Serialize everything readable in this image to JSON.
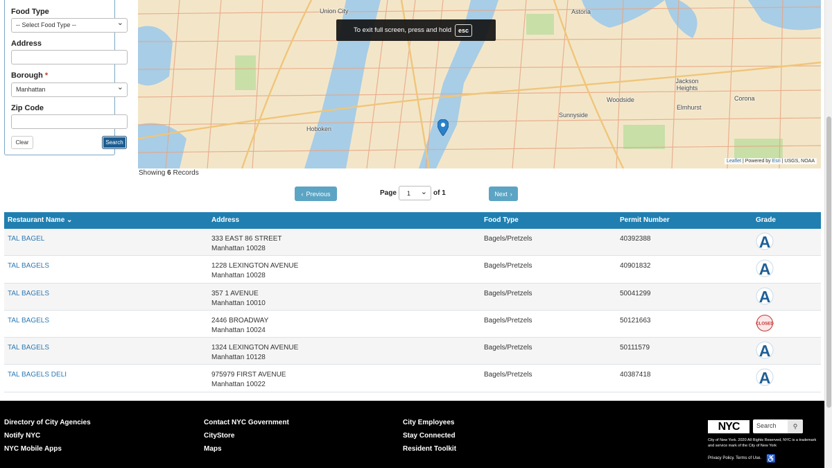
{
  "search_panel": {
    "food_type_label": "Food Type",
    "food_type_value": "-- Select Food Type --",
    "address_label": "Address",
    "address_value": "",
    "borough_label": "Borough",
    "borough_required": "*",
    "borough_value": "Manhattan",
    "zip_label": "Zip Code",
    "zip_value": "",
    "clear_label": "Clear",
    "search_label": "Search"
  },
  "map": {
    "places": {
      "union_city": "Union City",
      "astoria": "Astoria",
      "jackson_heights": "Jackson Heights",
      "woodside": "Woodside",
      "elmhurst": "Elmhurst",
      "corona": "Corona",
      "sunnyside": "Sunnyside",
      "hoboken": "Hoboken"
    },
    "fullscreen_toast_text": "To exit full screen, press and hold",
    "fullscreen_toast_key": "esc",
    "attribution_leaflet": "Leaflet",
    "attribution_powered": "| Powered by",
    "attribution_esri": "Esri",
    "attribution_rest": "| USGS, NOAA"
  },
  "results": {
    "showing_prefix": "Showing",
    "showing_count": "6",
    "showing_suffix": "Records"
  },
  "pagination": {
    "previous_label": "Previous",
    "page_label": "Page",
    "page_value": "1",
    "of_label": "of 1",
    "next_label": "Next"
  },
  "table": {
    "headers": {
      "name": "Restaurant Name",
      "address": "Address",
      "food_type": "Food Type",
      "permit": "Permit Number",
      "grade": "Grade"
    },
    "rows": [
      {
        "name": "TAL BAGEL",
        "address1": "333 EAST 86 STREET",
        "address2": "Manhattan 10028",
        "food_type": "Bagels/Pretzels",
        "permit": "40392388",
        "grade": "A"
      },
      {
        "name": "TAL BAGELS",
        "address1": "1228 LEXINGTON AVENUE",
        "address2": "Manhattan 10028",
        "food_type": "Bagels/Pretzels",
        "permit": "40901832",
        "grade": "A"
      },
      {
        "name": "TAL BAGELS",
        "address1": "357 1 AVENUE",
        "address2": "Manhattan 10010",
        "food_type": "Bagels/Pretzels",
        "permit": "50041299",
        "grade": "A"
      },
      {
        "name": "TAL BAGELS",
        "address1": "2446 BROADWAY",
        "address2": "Manhattan 10024",
        "food_type": "Bagels/Pretzels",
        "permit": "50121663",
        "grade": "CLOSED"
      },
      {
        "name": "TAL BAGELS",
        "address1": "1324 LEXINGTON AVENUE",
        "address2": "Manhattan 10128",
        "food_type": "Bagels/Pretzels",
        "permit": "50111579",
        "grade": "A"
      },
      {
        "name": "TAL BAGELS DELI",
        "address1": "975979 FIRST AVENUE",
        "address2": "Manhattan 10022",
        "food_type": "Bagels/Pretzels",
        "permit": "40387418",
        "grade": "A"
      }
    ]
  },
  "footer": {
    "col1": [
      "Directory of City Agencies",
      "Notify NYC",
      "NYC Mobile Apps"
    ],
    "col2": [
      "Contact NYC Government",
      "CityStore",
      "Maps"
    ],
    "col3": [
      "City Employees",
      "Stay Connected",
      "Resident Toolkit"
    ],
    "logo_text": "NYC",
    "search_placeholder": "Search",
    "copyright": "City of New York. 2020 All Rights Reserved, NYC is a trademark and service mark of the City of New York",
    "policy": "Privacy Policy. Terms of Use."
  }
}
